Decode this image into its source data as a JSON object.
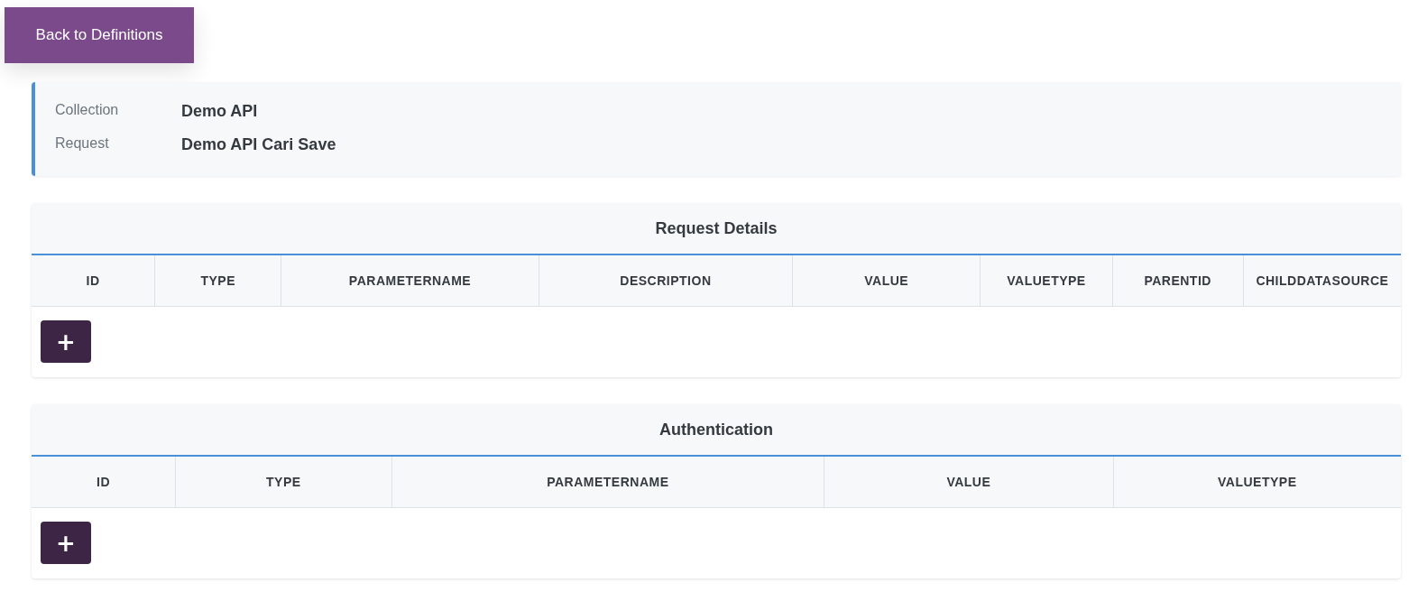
{
  "back_button": {
    "label": "Back to Definitions"
  },
  "info": [
    {
      "label": "Collection",
      "value": "Demo API"
    },
    {
      "label": "Request",
      "value": "Demo API Cari Save"
    }
  ],
  "sections": [
    {
      "title": "Request Details",
      "columns": [
        "ID",
        "TYPE",
        "PARAMETERNAME",
        "DESCRIPTION",
        "VALUE",
        "VALUETYPE",
        "PARENTID",
        "CHILDDATASOURCE"
      ],
      "add_button": "+"
    },
    {
      "title": "Authentication",
      "columns": [
        "ID",
        "TYPE",
        "PARAMETERNAME",
        "VALUE",
        "VALUETYPE"
      ],
      "add_button": "+"
    }
  ]
}
